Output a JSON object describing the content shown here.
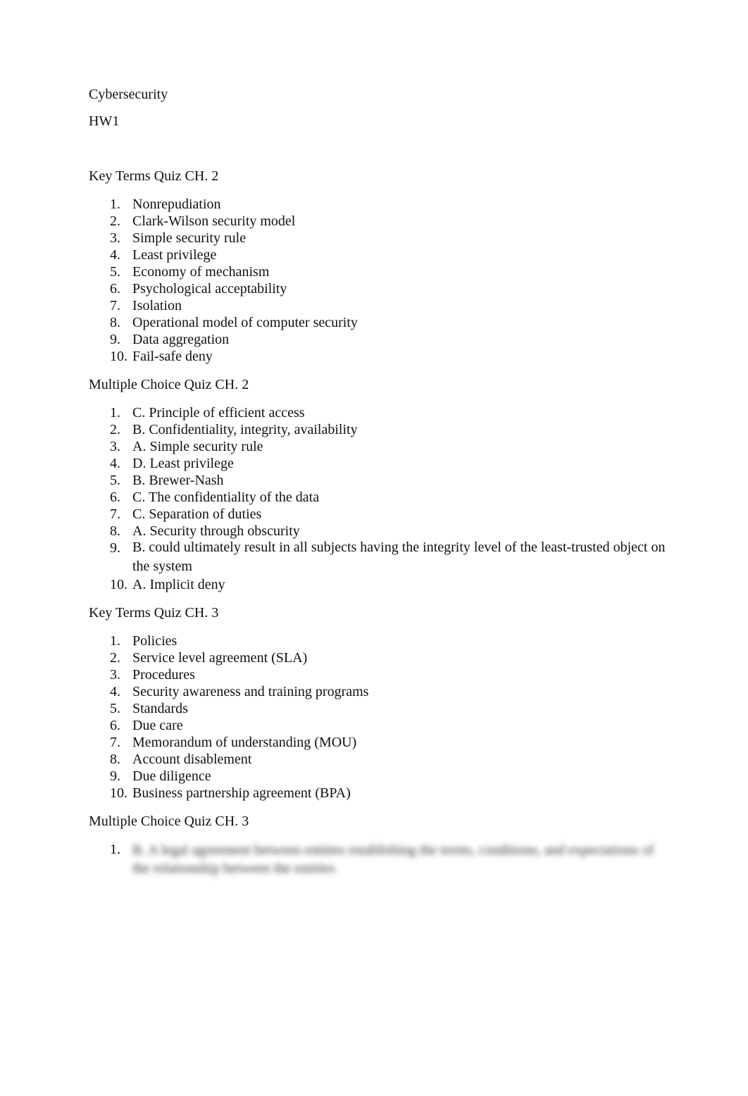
{
  "document": {
    "title": "Cybersecurity",
    "subtitle": "HW1",
    "sections": [
      {
        "heading": "Key Terms Quiz CH. 2",
        "items": [
          {
            "num": "1.",
            "text": "Nonrepudiation"
          },
          {
            "num": "2.",
            "text": "Clark-Wilson security model"
          },
          {
            "num": "3.",
            "text": "Simple security rule"
          },
          {
            "num": "4.",
            "text": "Least privilege"
          },
          {
            "num": "5.",
            "text": "Economy of mechanism"
          },
          {
            "num": "6.",
            "text": "Psychological acceptability"
          },
          {
            "num": "7.",
            "text": "Isolation"
          },
          {
            "num": "8.",
            "text": "Operational model of computer security"
          },
          {
            "num": "9.",
            "text": "Data aggregation"
          },
          {
            "num": "10.",
            "text": "Fail-safe deny"
          }
        ]
      },
      {
        "heading": "Multiple Choice Quiz CH. 2",
        "items": [
          {
            "num": "1.",
            "text": "C. Principle of efficient access"
          },
          {
            "num": "2.",
            "text": "B. Confidentiality, integrity, availability"
          },
          {
            "num": "3.",
            "text": "A. Simple security rule"
          },
          {
            "num": "4.",
            "text": "D. Least privilege"
          },
          {
            "num": "5.",
            "text": "B. Brewer-Nash"
          },
          {
            "num": "6.",
            "text": "C. The confidentiality of the data"
          },
          {
            "num": "7.",
            "text": "C. Separation of duties"
          },
          {
            "num": "8.",
            "text": "A. Security through obscurity"
          },
          {
            "num": "9.",
            "text": "B. could ultimately result in all subjects having the integrity level of the least-trusted object on the system"
          },
          {
            "num": "10.",
            "text": "A. Implicit deny"
          }
        ]
      },
      {
        "heading": "Key Terms Quiz CH. 3",
        "items": [
          {
            "num": "1.",
            "text": "Policies"
          },
          {
            "num": "2.",
            "text": "Service level agreement (SLA)"
          },
          {
            "num": "3.",
            "text": "Procedures"
          },
          {
            "num": "4.",
            "text": "Security awareness and training programs"
          },
          {
            "num": "5.",
            "text": "Standards"
          },
          {
            "num": "6.",
            "text": "Due care"
          },
          {
            "num": "7.",
            "text": "Memorandum of understanding (MOU)"
          },
          {
            "num": "8.",
            "text": "Account disablement"
          },
          {
            "num": "9.",
            "text": "Due diligence"
          },
          {
            "num": "10.",
            "text": "Business partnership agreement (BPA)"
          }
        ]
      },
      {
        "heading": "Multiple Choice Quiz CH. 3",
        "items": [
          {
            "num": "1.",
            "text": "(blurred / obscured answer text)"
          }
        ]
      }
    ]
  }
}
